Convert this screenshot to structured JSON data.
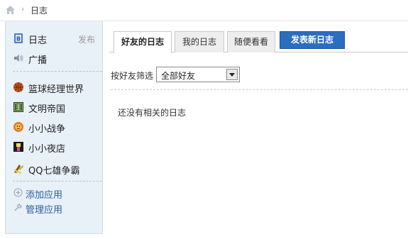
{
  "breadcrumb": {
    "separator": "›",
    "current": "日志"
  },
  "sidebar": {
    "primary": [
      {
        "label": "日志",
        "extra": "发布",
        "icon": "blog-icon"
      },
      {
        "label": "广播",
        "icon": "broadcast-icon"
      }
    ],
    "apps": [
      {
        "label": "篮球经理世界",
        "icon": "basketball-icon"
      },
      {
        "label": "文明帝国",
        "icon": "civilization-icon"
      },
      {
        "label": "小小战争",
        "icon": "war-icon"
      },
      {
        "label": "小小夜店",
        "icon": "nightclub-icon"
      },
      {
        "label": "QQ七雄争霸",
        "icon": "qq-seven-heroes-icon"
      }
    ],
    "links": [
      {
        "label": "添加应用",
        "icon": "plus-icon"
      },
      {
        "label": "管理应用",
        "icon": "wrench-icon"
      }
    ]
  },
  "tabs": [
    {
      "label": "好友的日志",
      "active": true
    },
    {
      "label": "我的日志",
      "active": false
    },
    {
      "label": "随便看看",
      "active": false
    }
  ],
  "publish_button": "发表新日志",
  "filter": {
    "label": "按好友筛选",
    "selected": "全部好友"
  },
  "empty_message": "还没有相关的日志",
  "colors": {
    "sidebar_bg": "#e8f0f8",
    "link": "#2a5f9e",
    "button": "#2b6dbf"
  }
}
